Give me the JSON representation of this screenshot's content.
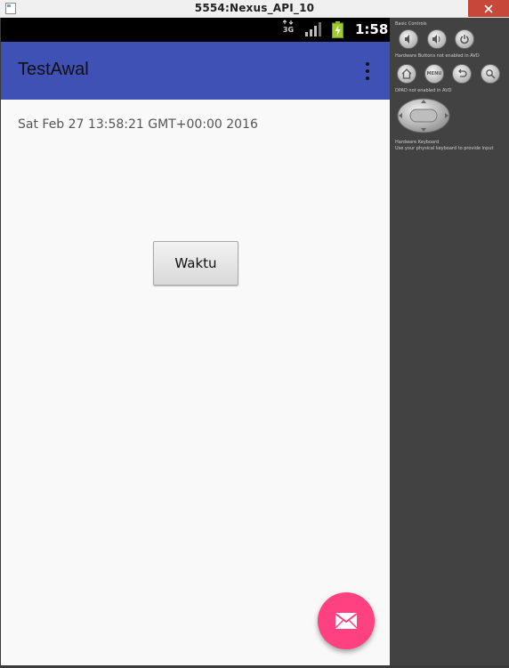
{
  "window": {
    "title": "5554:Nexus_API_10"
  },
  "status_bar": {
    "network": "3G",
    "time": "1:58"
  },
  "action_bar": {
    "title": "TestAwal",
    "overflow_icon": "more-vert-icon"
  },
  "content": {
    "datetime_text": "Sat Feb 27 13:58:21 GMT+00:00 2016",
    "button_label": "Waktu"
  },
  "fab": {
    "icon": "mail-icon",
    "color": "#ff4081"
  },
  "side_panel": {
    "basic_controls_label": "Basic Controls",
    "hardware_buttons_label": "Hardware Buttons not enabled in AVD",
    "dpad_label": "DPAD not enabled in AVD",
    "keyboard_label": "Hardware Keyboard",
    "keyboard_note": "Use your physical keyboard to provide input",
    "menu_label": "MENU"
  },
  "colors": {
    "primary": "#3f51b5",
    "accent": "#ff4081",
    "status_bar": "#000000",
    "panel": "#424242"
  }
}
